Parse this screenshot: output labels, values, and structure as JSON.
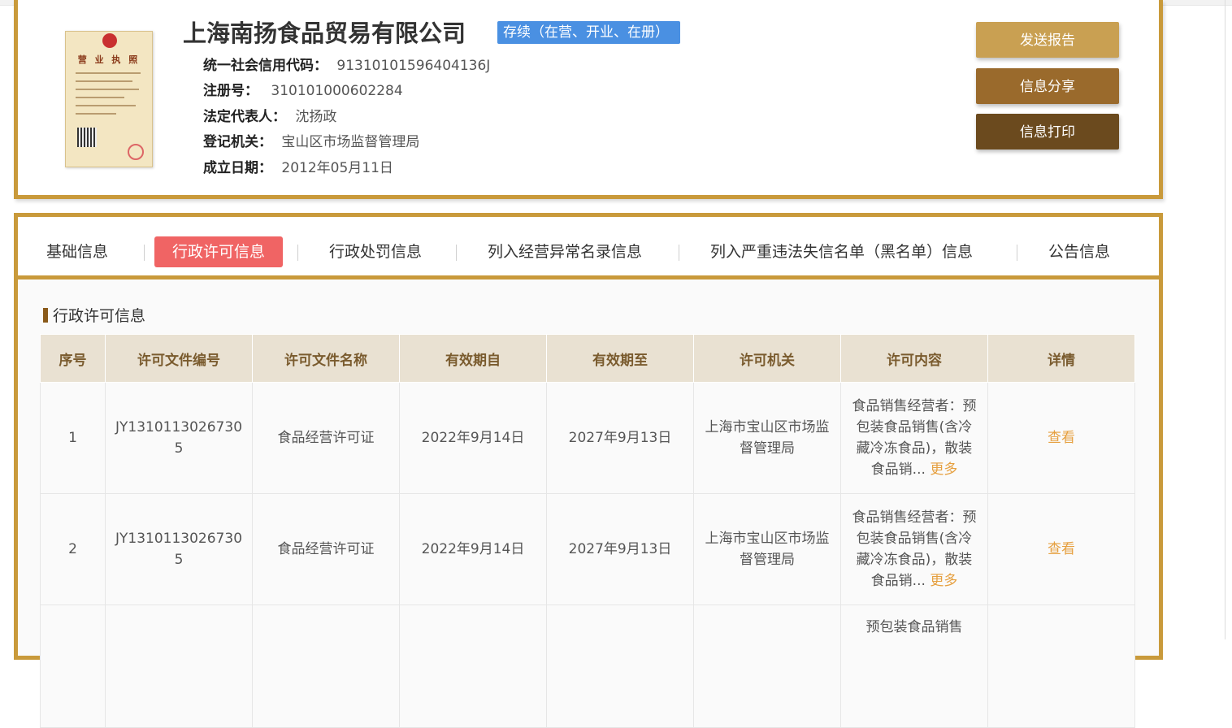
{
  "company": {
    "name": "上海南扬食品贸易有限公司",
    "status": "存续（在营、开业、在册）",
    "license_image_title": "营 业 执 照",
    "fields": [
      {
        "label": "统一社会信用代码：",
        "value": "91310101596404136J"
      },
      {
        "label": "注册号：",
        "value": "310101000602284"
      },
      {
        "label": "法定代表人：",
        "value": "沈扬政"
      },
      {
        "label": "登记机关：",
        "value": "宝山区市场监督管理局"
      },
      {
        "label": "成立日期：",
        "value": "2012年05月11日"
      }
    ]
  },
  "actions": {
    "send_report": "发送报告",
    "share": "信息分享",
    "print": "信息打印"
  },
  "tabs": [
    {
      "label": "基础信息"
    },
    {
      "label": "行政许可信息"
    },
    {
      "label": "行政处罚信息"
    },
    {
      "label": "列入经营异常名录信息"
    },
    {
      "label": "列入严重违法失信名单（黑名单）信息"
    },
    {
      "label": "公告信息"
    }
  ],
  "section": {
    "title": "行政许可信息"
  },
  "table": {
    "headers": [
      "序号",
      "许可文件编号",
      "许可文件名称",
      "有效期自",
      "有效期至",
      "许可机关",
      "许可内容",
      "详情"
    ],
    "rows": [
      {
        "no": "1",
        "doc_no": "JY13101130267305",
        "doc_name": "食品经营许可证",
        "valid_from": "2022年9月14日",
        "valid_to": "2027年9月13日",
        "authority": "上海市宝山区市场监督管理局",
        "content": "食品销售经营者：预包装食品销售(含冷藏冷冻食品)，散装食品销...",
        "more": "更多",
        "detail": "查看"
      },
      {
        "no": "2",
        "doc_no": "JY13101130267305",
        "doc_name": "食品经营许可证",
        "valid_from": "2022年9月14日",
        "valid_to": "2027年9月13日",
        "authority": "上海市宝山区市场监督管理局",
        "content": "食品销售经营者：预包装食品销售(含冷藏冷冻食品)，散装食品销...",
        "more": "更多",
        "detail": "查看"
      },
      {
        "no": "",
        "doc_no": "",
        "doc_name": "",
        "valid_from": "",
        "valid_to": "",
        "authority": "",
        "content": "预包装食品销售",
        "more": "",
        "detail": ""
      }
    ]
  },
  "colors": {
    "gold_border": "#c99a3b",
    "btn_send": "#c9a052",
    "btn_share": "#9a6a2c",
    "btn_print": "#6b4a1e",
    "status_badge": "#4a90e2",
    "active_tab": "#f06464",
    "table_header_bg": "#e9e1d2",
    "link": "#e6a040"
  },
  "icons": [
    "national-emblem-icon"
  ]
}
